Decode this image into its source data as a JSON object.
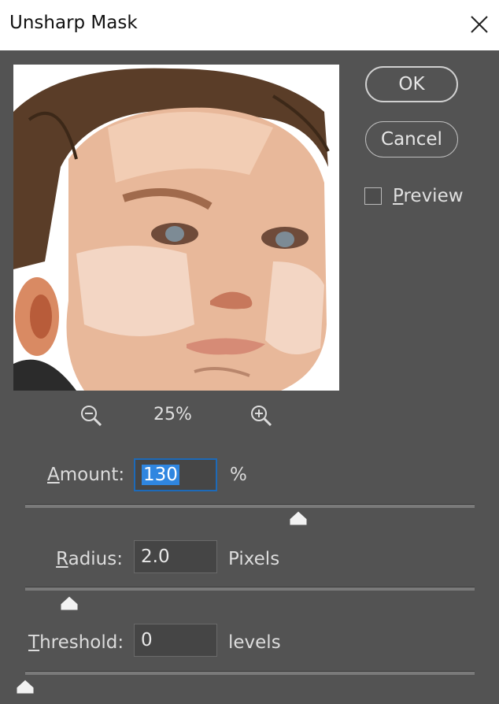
{
  "dialog": {
    "title": "Unsharp Mask",
    "close_icon": "close-icon"
  },
  "buttons": {
    "ok_label": "OK",
    "cancel_label": "Cancel"
  },
  "preview_toggle": {
    "label": "Preview",
    "checked": false
  },
  "zoom": {
    "level": "25%",
    "zoom_out_icon": "zoom-out-icon",
    "zoom_in_icon": "zoom-in-icon"
  },
  "params": {
    "amount": {
      "label": "Amount:",
      "value": "130",
      "unit": "%",
      "slider_fraction": 0.62
    },
    "radius": {
      "label": "Radius:",
      "value": "2.0",
      "unit": "Pixels",
      "slider_fraction": 0.1
    },
    "threshold": {
      "label": "Threshold:",
      "value": "0",
      "unit": "levels",
      "slider_fraction": 0.0
    }
  },
  "colors": {
    "background": "#535353",
    "focus_accent": "#1d6ab8",
    "selection": "#2f86e0"
  }
}
